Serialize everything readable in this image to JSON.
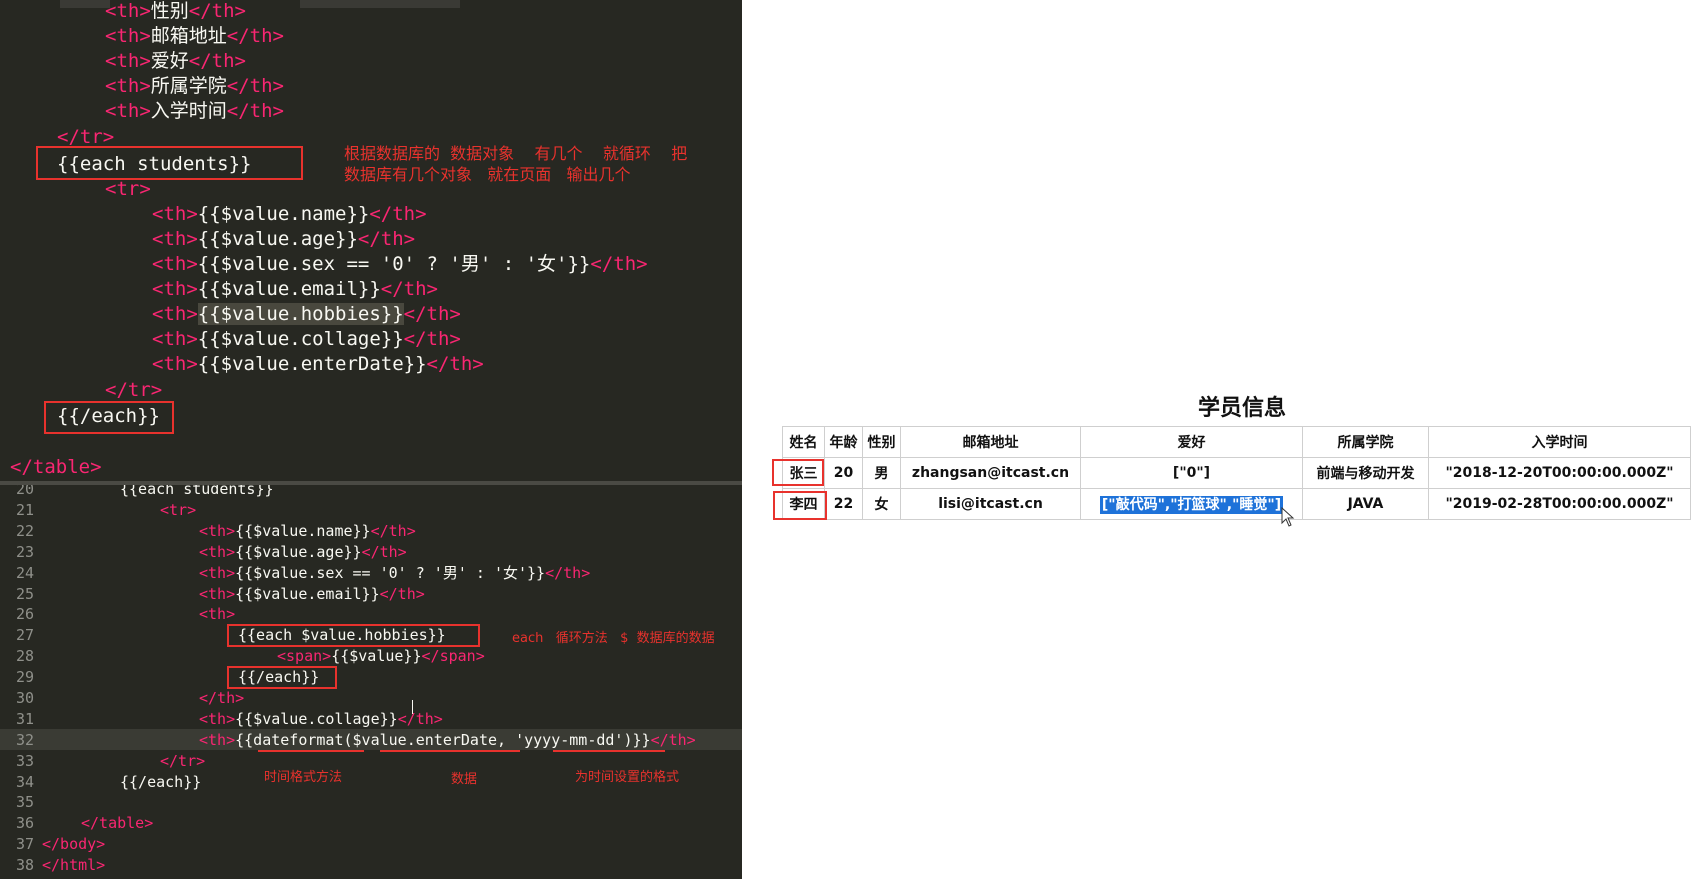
{
  "colors": {
    "editor_bg": "#272822",
    "tag": "#f92672",
    "text": "#f8f8f2",
    "annotation": "#e8322d",
    "selection": "#1e72d9"
  },
  "top_editor": {
    "lines": [
      {
        "indent": "    ",
        "tag": "th",
        "text": "性别"
      },
      {
        "indent": "    ",
        "tag": "th",
        "text": "邮箱地址"
      },
      {
        "indent": "    ",
        "tag": "th",
        "text": "爱好"
      },
      {
        "indent": "    ",
        "tag": "th",
        "text": "所属学院"
      },
      {
        "indent": "    ",
        "tag": "th",
        "text": "入学时间"
      }
    ],
    "close_tr": "</tr>",
    "each_open": "{{each students}}",
    "open_tr": "<tr>",
    "row_cells": [
      "{{$value.name}}",
      "{{$value.age}}",
      "{{$value.sex == '0' ? '男' : '女'}}",
      "{{$value.email}}",
      "{{$value.hobbies}}",
      "{{$value.collage}}",
      "{{$value.enterDate}}"
    ],
    "close_tr_inner": "</tr>",
    "each_close": "{{/each}}",
    "close_table": "</table>",
    "annotation_line1": "根据数据库的  数据对象    有几个    就循环    把",
    "annotation_line2": "数据库有几个对象   就在页面   输出几个"
  },
  "bottom_editor": {
    "line_numbers": [
      "20",
      "21",
      "22",
      "23",
      "24",
      "25",
      "26",
      "27",
      "28",
      "29",
      "30",
      "31",
      "32",
      "33",
      "34",
      "35",
      "36",
      "37",
      "38"
    ],
    "line20": "{{each students}}",
    "line21": "<tr>",
    "cells": [
      "{{$value.name}}",
      "{{$value.age}}",
      "{{$value.sex == '0' ? '男' : '女'}}",
      "{{$value.email}}"
    ],
    "line26": "<th>",
    "line27": "{{each $value.hobbies}}",
    "line28_tag": "span",
    "line28_text": "{{$value}}",
    "line29": "{{/each}}",
    "line30": "</th>",
    "line31": "{{$value.collage}}",
    "line32_fn": "{{dateformat(",
    "line32_arg": "$value.enterDate",
    "line32_sep": ", ",
    "line32_fmt": "'yyyy-mm-dd'",
    "line32_end": ")}}",
    "line33": "</tr>",
    "line34": "{{/each}}",
    "line36": "</table>",
    "line37": "</body>",
    "line38": "</html>",
    "anno_each": "each   循环方法   $  数据库的数据",
    "anno_fn": "时间格式方法",
    "anno_data": "数据",
    "anno_fmt": "为时间设置的格式"
  },
  "browser": {
    "title": "学员信息",
    "headers": [
      "姓名",
      "年龄",
      "性别",
      "邮箱地址",
      "爱好",
      "所属学院",
      "入学时间"
    ],
    "rows": [
      [
        "张三",
        "20",
        "男",
        "zhangsan@itcast.cn",
        "[\"0\"]",
        "前端与移动开发",
        "\"2018-12-20T00:00:00.000Z\""
      ],
      [
        "李四",
        "22",
        "女",
        "lisi@itcast.cn",
        "[\"敲代码\",\"打篮球\",\"睡觉\"]",
        "JAVA",
        "\"2019-02-28T00:00:00.000Z\""
      ]
    ]
  }
}
